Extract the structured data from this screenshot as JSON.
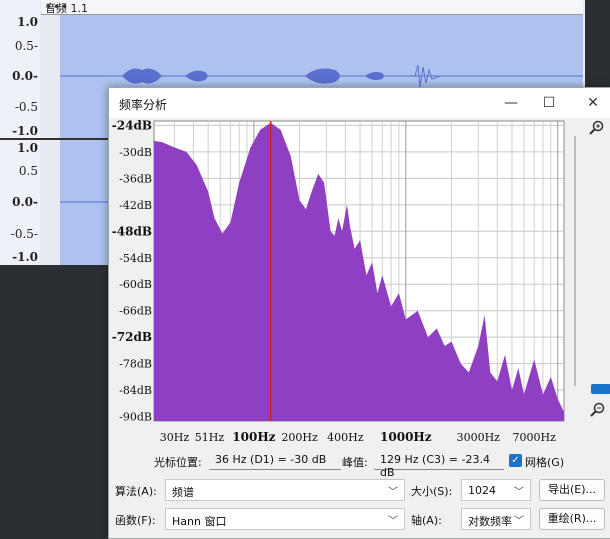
{
  "track": {
    "title": "音频 1.1",
    "more": "•••",
    "ruler_upper": [
      "1.0",
      "0.5-",
      "0.0-",
      "-0.5",
      "-1.0"
    ],
    "ruler_lower": [
      "1.0",
      "0.5",
      "0.0-",
      "-0.5-",
      "-1.0"
    ]
  },
  "dialog": {
    "title": "频率分析",
    "minimize": "—",
    "maximize": "☐",
    "close": "✕",
    "cursor_label": "光标位置:",
    "cursor_value": "36 Hz (D1) = -30 dB",
    "peak_label": "峰值:",
    "peak_value": "129 Hz (C3) = -23.4 dB",
    "grid_label": "网格(G)",
    "algorithm_label": "算法(A):",
    "algorithm_value": "频谱",
    "size_label": "大小(S):",
    "size_value": "1024",
    "export_button": "导出(E)...",
    "function_label": "函数(F):",
    "function_value": "Hann 窗口",
    "axis_label": "轴(A):",
    "axis_value": "对数频率",
    "replot_button": "重绘(R)...",
    "zoom_in_icon": "zoom-in-icon",
    "zoom_out_icon": "zoom-out-icon",
    "accent_color": "#8e3fc2",
    "cursor_line_color": "#d2232a"
  },
  "chart_data": {
    "type": "area",
    "y_tick_labels": [
      "-24dB",
      "-30dB",
      "-36dB",
      "-42dB",
      "-48dB",
      "-54dB",
      "-60dB",
      "-66dB",
      "-72dB",
      "-78dB",
      "-84dB",
      "-90dB"
    ],
    "y_tick_values": [
      -24,
      -30,
      -36,
      -42,
      -48,
      -54,
      -60,
      -66,
      -72,
      -78,
      -84,
      -90
    ],
    "x_tick_labels": [
      "30Hz",
      "51Hz",
      "100Hz",
      "200Hz",
      "400Hz",
      "1000Hz",
      "3000Hz",
      "7000Hz"
    ],
    "x_tick_values": [
      30,
      51,
      100,
      200,
      400,
      1000,
      3000,
      7000
    ],
    "xlim": [
      22,
      11000
    ],
    "ylim": [
      -91,
      -23
    ],
    "log_x": true,
    "grid": true,
    "spectrum": [
      [
        22,
        -27.5
      ],
      [
        25,
        -27.8
      ],
      [
        30,
        -29
      ],
      [
        36,
        -30
      ],
      [
        42,
        -33
      ],
      [
        50,
        -39
      ],
      [
        55,
        -45
      ],
      [
        62,
        -48.5
      ],
      [
        70,
        -46
      ],
      [
        80,
        -37
      ],
      [
        95,
        -29
      ],
      [
        110,
        -25
      ],
      [
        129,
        -23.4
      ],
      [
        150,
        -25
      ],
      [
        175,
        -31
      ],
      [
        200,
        -41
      ],
      [
        220,
        -43
      ],
      [
        240,
        -39
      ],
      [
        265,
        -35
      ],
      [
        290,
        -37
      ],
      [
        320,
        -48
      ],
      [
        340,
        -49
      ],
      [
        360,
        -45
      ],
      [
        380,
        -48
      ],
      [
        410,
        -42
      ],
      [
        430,
        -47
      ],
      [
        460,
        -52
      ],
      [
        500,
        -50
      ],
      [
        550,
        -58
      ],
      [
        600,
        -55
      ],
      [
        650,
        -62
      ],
      [
        700,
        -58
      ],
      [
        800,
        -65
      ],
      [
        900,
        -62
      ],
      [
        1000,
        -68
      ],
      [
        1200,
        -66
      ],
      [
        1400,
        -72
      ],
      [
        1600,
        -70
      ],
      [
        1800,
        -74
      ],
      [
        2000,
        -73
      ],
      [
        2300,
        -78
      ],
      [
        2600,
        -80
      ],
      [
        3000,
        -74
      ],
      [
        3300,
        -67
      ],
      [
        3600,
        -80
      ],
      [
        4000,
        -82
      ],
      [
        4500,
        -76
      ],
      [
        5000,
        -84
      ],
      [
        5500,
        -79
      ],
      [
        6000,
        -85
      ],
      [
        7000,
        -77
      ],
      [
        8000,
        -85
      ],
      [
        9000,
        -81
      ],
      [
        10000,
        -86
      ],
      [
        11000,
        -89
      ]
    ],
    "cursor_x": 129
  }
}
